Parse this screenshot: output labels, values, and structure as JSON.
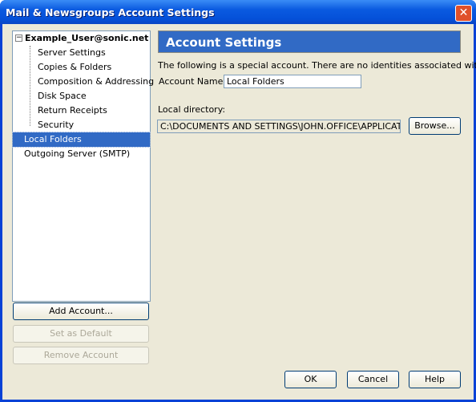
{
  "window": {
    "title": "Mail & Newsgroups Account Settings"
  },
  "tree": {
    "account": "Example_User@sonic.net",
    "children": [
      "Server Settings",
      "Copies & Folders",
      "Composition & Addressing",
      "Disk Space",
      "Return Receipts",
      "Security"
    ],
    "local_folders": "Local Folders",
    "outgoing": "Outgoing Server (SMTP)",
    "selected": "Local Folders"
  },
  "left_buttons": {
    "add": "Add Account...",
    "default": "Set as Default",
    "remove": "Remove Account"
  },
  "panel": {
    "header": "Account Settings",
    "note": "The following is a special account. There are no identities associated with it.",
    "account_name_label": "Account Name:",
    "account_name_value": "Local Folders",
    "local_dir_label": "Local directory:",
    "local_dir_value": "C:\\DOCUMENTS AND SETTINGS\\JOHN.OFFICE\\APPLICATION D",
    "browse": "Browse..."
  },
  "footer": {
    "ok": "OK",
    "cancel": "Cancel",
    "help": "Help"
  },
  "colors": {
    "selection": "#316ac5",
    "titlebar": "#0a5ae0"
  }
}
